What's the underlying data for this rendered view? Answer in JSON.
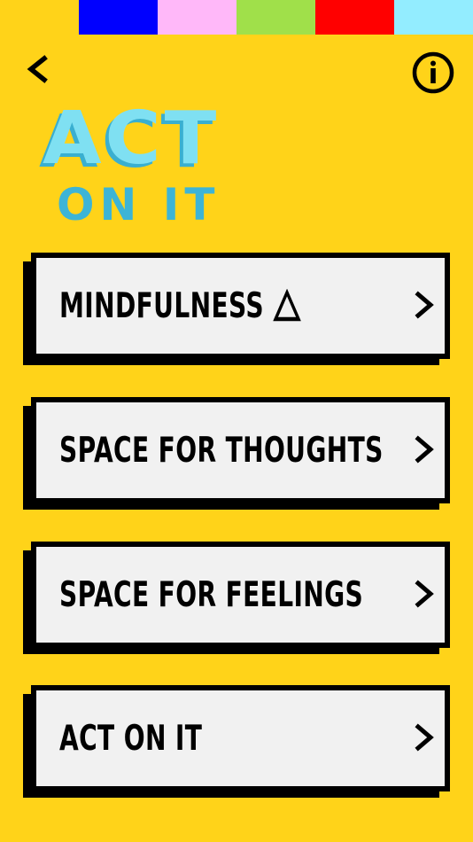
{
  "color_strip": {
    "swatches": [
      {
        "name": "blue",
        "color": "#0000FF"
      },
      {
        "name": "pink",
        "color": "#FFB8F9"
      },
      {
        "name": "green",
        "color": "#A0E04A"
      },
      {
        "name": "red",
        "color": "#FF0000"
      },
      {
        "name": "cyan",
        "color": "#93EDFF"
      }
    ]
  },
  "header": {
    "back_icon": "chevron-left-icon",
    "info_icon": "info-icon"
  },
  "logo": {
    "line1": "ACT",
    "line2": "ON IT",
    "colors": {
      "face": "#7FE0F2",
      "shade": "#3AAFD0",
      "line2": "#3DB4D6"
    }
  },
  "menu": {
    "items": [
      {
        "label": "MINDFULNESS",
        "icon": "triangle-icon",
        "chevron": "chevron-right-icon"
      },
      {
        "label": "SPACE FOR THOUGHTS",
        "chevron": "chevron-right-icon"
      },
      {
        "label": "SPACE FOR FEELINGS",
        "chevron": "chevron-right-icon"
      },
      {
        "label": "ACT ON IT",
        "chevron": "chevron-right-icon"
      }
    ]
  },
  "theme": {
    "background": "#FFD319",
    "card": "#F1F1F1",
    "ink": "#000000"
  }
}
